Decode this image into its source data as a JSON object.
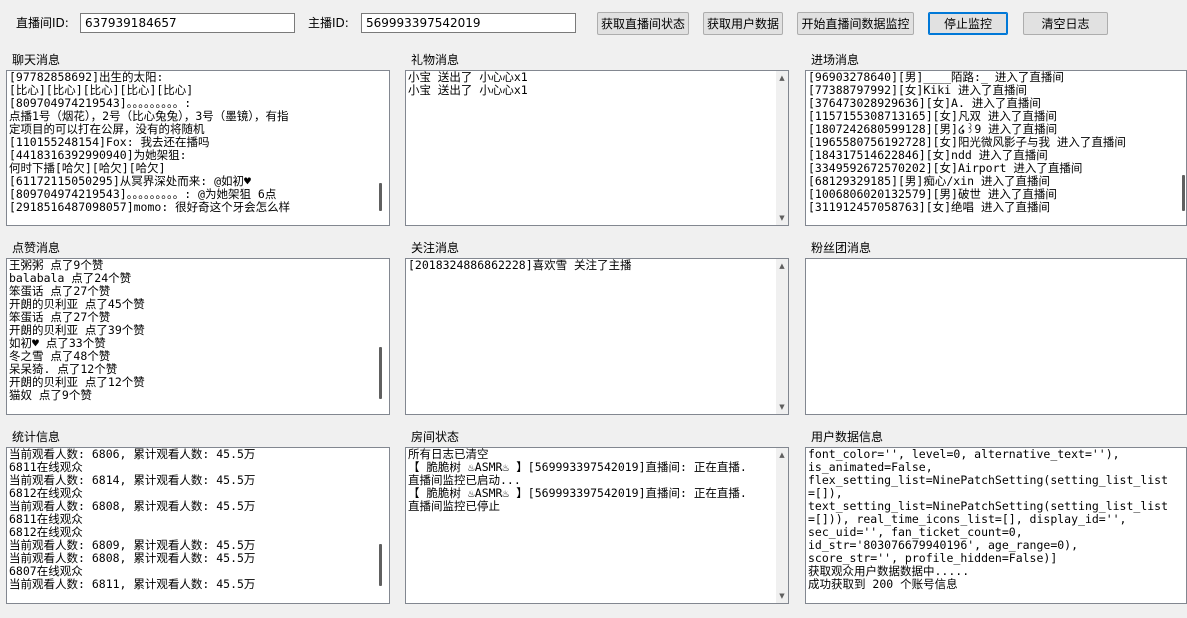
{
  "toolbar": {
    "room_id_label": "直播间ID:",
    "room_id_value": "637939184657",
    "anchor_id_label": "主播ID:",
    "anchor_id_value": "569993397542019",
    "buttons": {
      "get_status": "获取直播间状态",
      "get_user_data": "获取用户数据",
      "start_monitor": "开始直播间数据监控",
      "stop_monitor": "停止监控",
      "clear_log": "清空日志"
    }
  },
  "panels": {
    "chat": {
      "title": "聊天消息",
      "lines": [
        "[97782858692]出生的太阳:",
        "[比心][比心][比心][比心][比心]",
        "[809704974219543]。。。。。。。。。:",
        "点播1号（烟花），2号（比心兔兔），3号（墨镜），有指",
        "定项目的可以打在公屏，没有的将随机",
        "[110155248154]Fox: 我去还在播吗",
        "[4418316392990940]为她架狙:",
        "何时下播[哈欠][哈欠][哈欠]",
        "[61172115050295]从冥界深处而来: @如初♥",
        "[809704974219543]。。。。。。。。。: @为她架狙 6点",
        "[2918516487098057]momo: 很好奇这个牙会怎么样"
      ]
    },
    "gifts": {
      "title": "礼物消息",
      "lines": [
        "小宝 送出了 小心心x1",
        "小宝 送出了 小心心x1"
      ]
    },
    "enter": {
      "title": "进场消息",
      "lines": [
        "[96903278640][男]____陌路:_ 进入了直播间",
        "[77388797992][女]Kiki 进入了直播间",
        "[376473028929636][女]A. 进入了直播间",
        "[1157155308713165][女]凡双 进入了直播间",
        "[1807242680599128][男]໒꒱9 进入了直播间",
        "[1965580756192728][女]阳光微风影子与我 进入了直播间",
        "[1843175146228​46][女]ndd 进入了直播间",
        "[3349592672570202][女]Airport 进入了直播间",
        "[68129329185][男]痴心/xin 进入了直播间",
        "[1006806020132579][男]破世 进入了直播间",
        "[311912457058763][女]绝唱 进入了直播间"
      ]
    },
    "likes": {
      "title": "点赞消息",
      "lines": [
        "王粥粥 点了9个赞",
        "balabala 点了24个赞",
        "笨蛋话 点了27个赞",
        "开朗的贝利亚 点了45个赞",
        "笨蛋话 点了27个赞",
        "开朗的贝利亚 点了39个赞",
        "如初♥ 点了33个赞",
        "冬之雪 点了48个赞",
        "呆呆猗. 点了12个赞",
        "开朗的贝利亚 点了12个赞",
        "猫奴 点了9个赞"
      ]
    },
    "follow": {
      "title": "关注消息",
      "lines": [
        "[2018324886862228]喜欢雪 关注了主播"
      ]
    },
    "fans": {
      "title": "粉丝团消息",
      "lines": []
    },
    "stats": {
      "title": "统计信息",
      "lines": [
        "当前观看人数: 6806, 累计观看人数: 45.5万",
        "6811在线观众",
        "当前观看人数: 6814, 累计观看人数: 45.5万",
        "6812在线观众",
        "当前观看人数: 6808, 累计观看人数: 45.5万",
        "6811在线观众",
        "6812在线观众",
        "当前观看人数: 6809, 累计观看人数: 45.5万",
        "当前观看人数: 6808, 累计观看人数: 45.5万",
        "6807在线观众",
        "当前观看人数: 6811, 累计观看人数: 45.5万"
      ]
    },
    "room": {
      "title": "房间状态",
      "lines": [
        "所有日志已清空",
        "【 脆脆树 ♨ASMR♨ 】[569993397542019]直播间: 正在直播.",
        "直播间监控已启动...",
        "【 脆脆树 ♨ASMR♨ 】[569993397542019]直播间: 正在直播.",
        "直播间监控已停止"
      ]
    },
    "user": {
      "title": "用户数据信息",
      "lines": [
        "font_color='', level=0, alternative_text=''),",
        "is_animated=False,",
        "flex_setting_list=NinePatchSetting(setting_list_list",
        "=[]),",
        "text_setting_list=NinePatchSetting(setting_list_list",
        "=[])), real_time_icons_list=[], display_id='',",
        "sec_uid='', fan_ticket_count=0,",
        "id_str='80307667994019​6', age_range=0),",
        "score_str='', profile_hidden=False)]",
        "获取观众用户数据数据中.....",
        "成功获取到 200 个账号信息"
      ]
    }
  }
}
